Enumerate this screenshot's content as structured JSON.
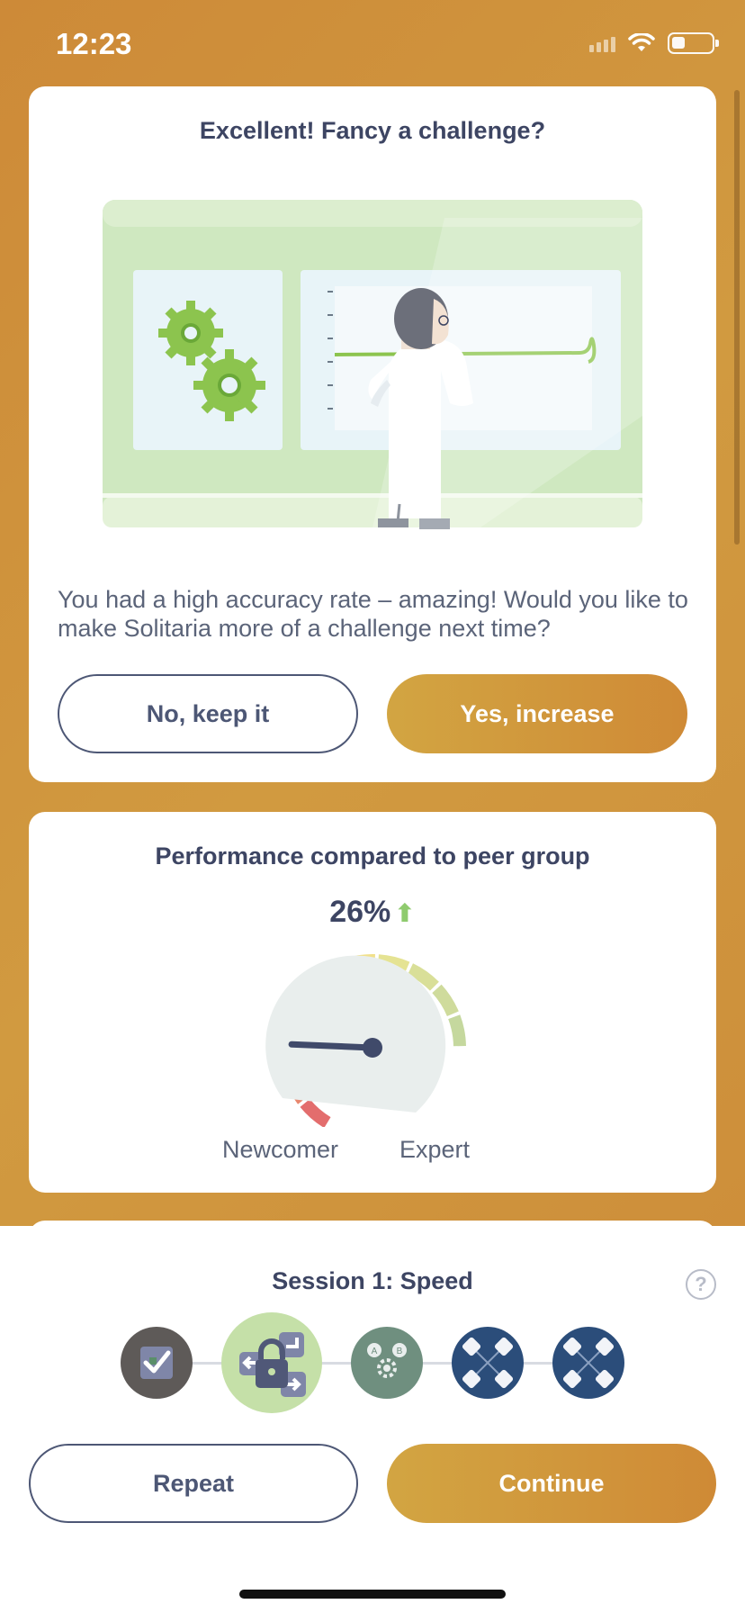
{
  "status_bar": {
    "time": "12:23"
  },
  "challenge_card": {
    "title": "Excellent! Fancy a challenge?",
    "body": "You had a high accuracy rate – amazing! Would you like to make Solitaria more of a challenge next time?",
    "decline_label": "No, keep it",
    "accept_label": "Yes, increase"
  },
  "performance_card": {
    "title": "Performance compared to peer group",
    "percent": "26%",
    "trend": "up",
    "gauge_value_fraction": 0.26,
    "low_label": "Newcomer",
    "high_label": "Expert"
  },
  "session": {
    "title": "Session 1: Speed",
    "steps": [
      {
        "icon": "checkbox-icon",
        "state": "completed"
      },
      {
        "icon": "lock-arrows-icon",
        "state": "current"
      },
      {
        "icon": "ab-gear-icon",
        "state": "upcoming"
      },
      {
        "icon": "card-grid-icon",
        "state": "upcoming"
      },
      {
        "icon": "card-grid-icon",
        "state": "upcoming"
      }
    ],
    "repeat_label": "Repeat",
    "continue_label": "Continue"
  },
  "colors": {
    "background": "#cd8a38",
    "accent_gradient_start": "#d2a542",
    "accent_gradient_end": "#cf8a36",
    "text_primary": "#3d4563",
    "trend_up": "#8fcb6e"
  }
}
